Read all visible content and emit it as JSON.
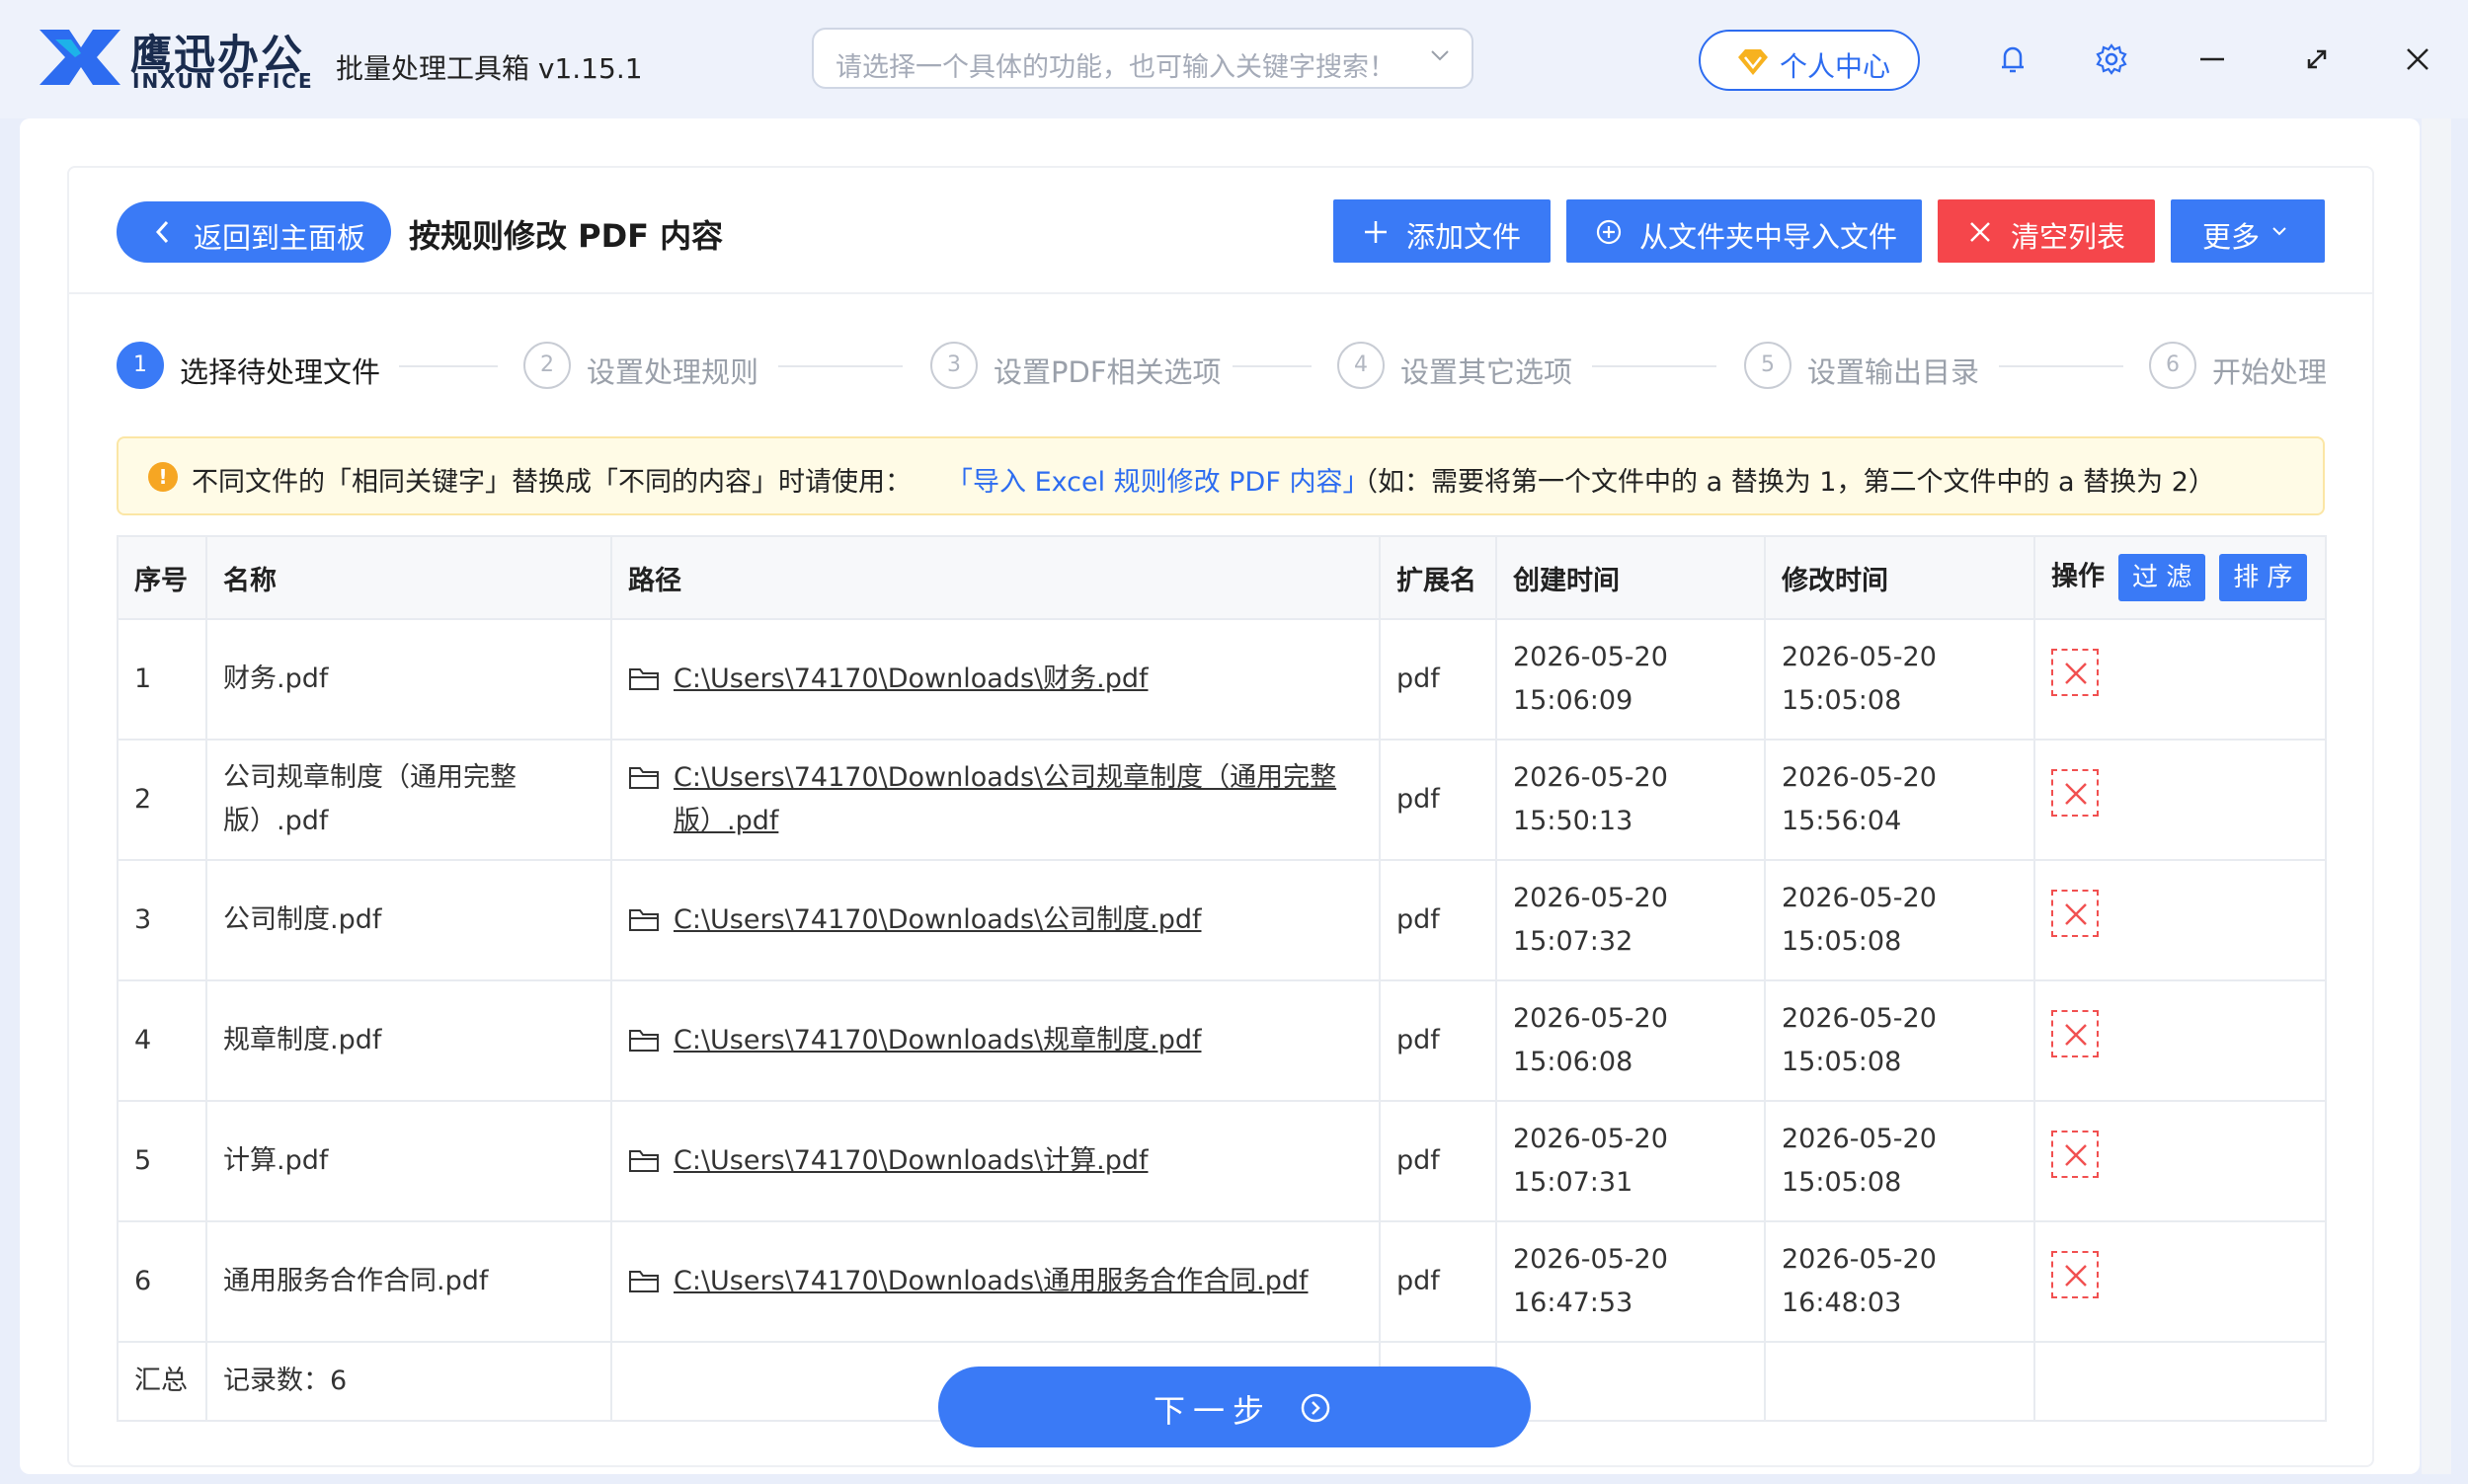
{
  "app": {
    "brand_cn": "鹰迅办公",
    "brand_en": "INXUN OFFICE",
    "title": "批量处理工具箱 v1.15.1",
    "search_placeholder": "请选择一个具体的功能，也可输入关键字搜索！",
    "user_center": "个人中心"
  },
  "toolbar": {
    "back": "返回到主面板",
    "page_title": "按规则修改 PDF 内容",
    "add_file": "添加文件",
    "import_folder": "从文件夹中导入文件",
    "clear_list": "清空列表",
    "more": "更多"
  },
  "steps": [
    {
      "num": "1",
      "label": "选择待处理文件",
      "active": true
    },
    {
      "num": "2",
      "label": "设置处理规则",
      "active": false
    },
    {
      "num": "3",
      "label": "设置PDF相关选项",
      "active": false
    },
    {
      "num": "4",
      "label": "设置其它选项",
      "active": false
    },
    {
      "num": "5",
      "label": "设置输出目录",
      "active": false
    },
    {
      "num": "6",
      "label": "开始处理",
      "active": false
    }
  ],
  "notice": {
    "prefix": "不同文件的「相同关键字」替换成「不同的内容」时请使用：",
    "link": "「导入 Excel 规则修改 PDF 内容」",
    "suffix": "（如：需要将第一个文件中的 a 替换为 1，第二个文件中的 a 替换为 2）"
  },
  "table": {
    "headers": {
      "index": "序号",
      "name": "名称",
      "path": "路径",
      "ext": "扩展名",
      "created": "创建时间",
      "modified": "修改时间",
      "ops": "操作",
      "filter": "过 滤",
      "sort": "排 序"
    },
    "rows": [
      {
        "index": "1",
        "name": "财务.pdf",
        "path": "C:\\Users\\74170\\Downloads\\财务.pdf",
        "ext": "pdf",
        "created": "2026-05-20 15:06:09",
        "modified": "2026-05-20 15:05:08"
      },
      {
        "index": "2",
        "name": "公司规章制度（通用完整版）.pdf",
        "path": "C:\\Users\\74170\\Downloads\\公司规章制度（通用完整版）.pdf",
        "ext": "pdf",
        "created": "2026-05-20 15:50:13",
        "modified": "2026-05-20 15:56:04"
      },
      {
        "index": "3",
        "name": "公司制度.pdf",
        "path": "C:\\Users\\74170\\Downloads\\公司制度.pdf",
        "ext": "pdf",
        "created": "2026-05-20 15:07:32",
        "modified": "2026-05-20 15:05:08"
      },
      {
        "index": "4",
        "name": "规章制度.pdf",
        "path": "C:\\Users\\74170\\Downloads\\规章制度.pdf",
        "ext": "pdf",
        "created": "2026-05-20 15:06:08",
        "modified": "2026-05-20 15:05:08"
      },
      {
        "index": "5",
        "name": "计算.pdf",
        "path": "C:\\Users\\74170\\Downloads\\计算.pdf",
        "ext": "pdf",
        "created": "2026-05-20 15:07:31",
        "modified": "2026-05-20 15:05:08"
      },
      {
        "index": "6",
        "name": "通用服务合作合同.pdf",
        "path": "C:\\Users\\74170\\Downloads\\通用服务合作合同.pdf",
        "ext": "pdf",
        "created": "2026-05-20 16:47:53",
        "modified": "2026-05-20 16:48:03"
      }
    ],
    "summary_label": "汇总",
    "summary_count": "记录数：6"
  },
  "next_button": "下一步",
  "colors": {
    "primary": "#3a7af6",
    "danger": "#f5464b",
    "notice_bg": "#fffbe6"
  }
}
